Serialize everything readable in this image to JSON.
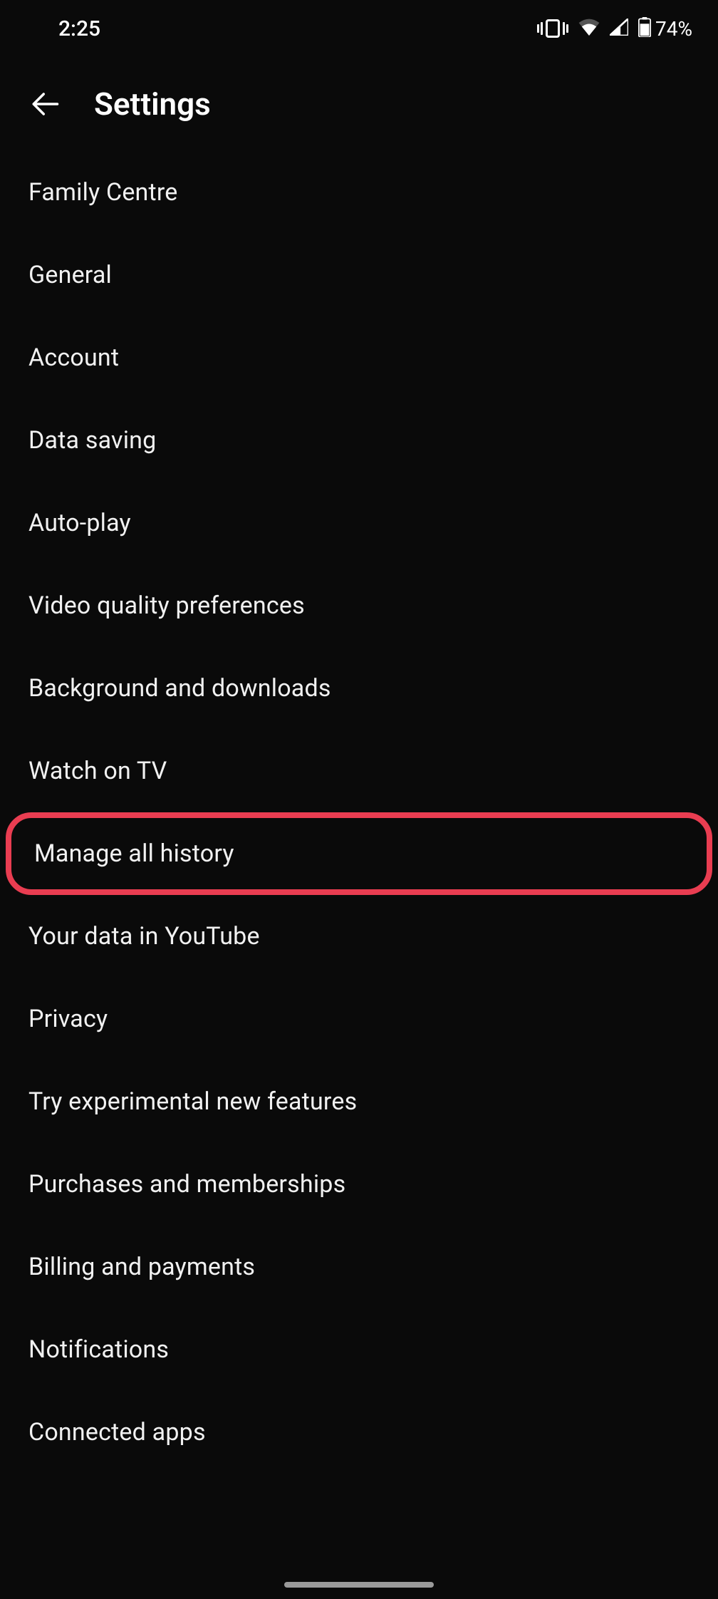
{
  "status_bar": {
    "time": "2:25",
    "battery_text": "74%"
  },
  "header": {
    "title": "Settings"
  },
  "settings": {
    "items": [
      {
        "label": "Family Centre"
      },
      {
        "label": "General"
      },
      {
        "label": "Account"
      },
      {
        "label": "Data saving"
      },
      {
        "label": "Auto-play"
      },
      {
        "label": "Video quality preferences"
      },
      {
        "label": "Background and downloads"
      },
      {
        "label": "Watch on TV"
      },
      {
        "label": "Manage all history"
      },
      {
        "label": "Your data in YouTube"
      },
      {
        "label": "Privacy"
      },
      {
        "label": "Try experimental new features"
      },
      {
        "label": "Purchases and memberships"
      },
      {
        "label": "Billing and payments"
      },
      {
        "label": "Notifications"
      },
      {
        "label": "Connected apps"
      }
    ]
  },
  "highlight_index": 8
}
